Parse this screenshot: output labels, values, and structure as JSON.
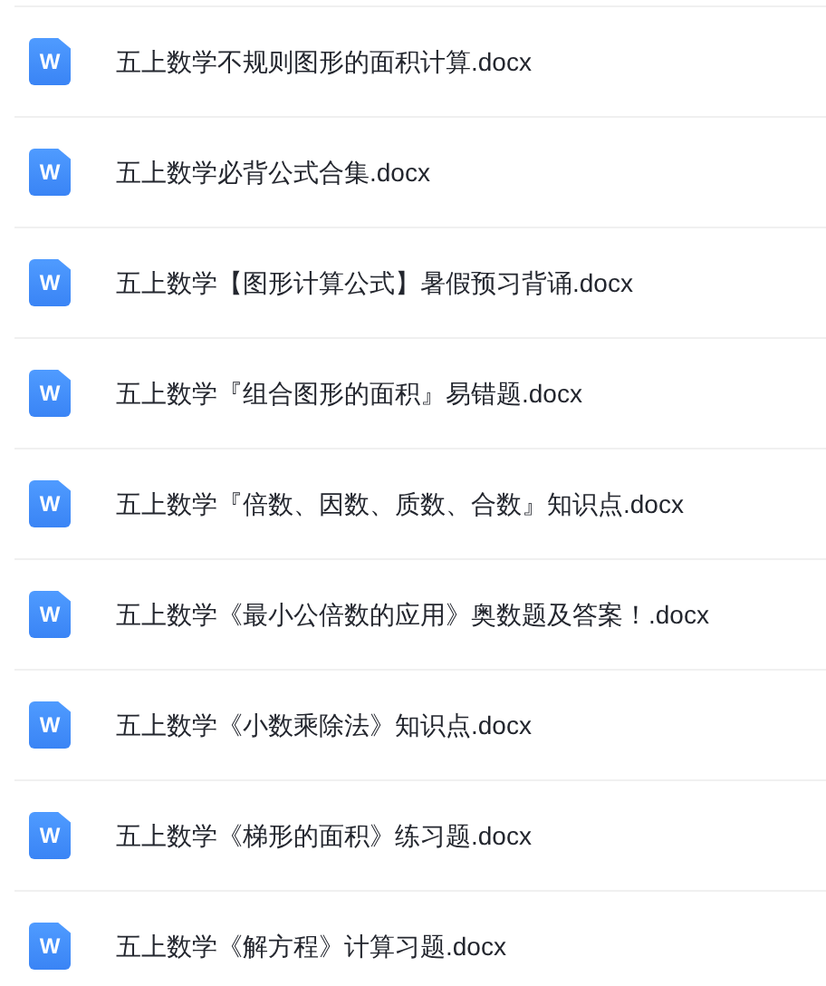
{
  "files": [
    {
      "icon_letter": "W",
      "name": "五上数学不规则图形的面积计算.docx"
    },
    {
      "icon_letter": "W",
      "name": "五上数学必背公式合集.docx"
    },
    {
      "icon_letter": "W",
      "name": "五上数学【图形计算公式】暑假预习背诵.docx"
    },
    {
      "icon_letter": "W",
      "name": "五上数学『组合图形的面积』易错题.docx"
    },
    {
      "icon_letter": "W",
      "name": "五上数学『倍数、因数、质数、合数』知识点.docx"
    },
    {
      "icon_letter": "W",
      "name": "五上数学《最小公倍数的应用》奥数题及答案！.docx"
    },
    {
      "icon_letter": "W",
      "name": "五上数学《小数乘除法》知识点.docx"
    },
    {
      "icon_letter": "W",
      "name": "五上数学《梯形的面积》练习题.docx"
    },
    {
      "icon_letter": "W",
      "name": "五上数学《解方程》计算习题.docx"
    }
  ]
}
